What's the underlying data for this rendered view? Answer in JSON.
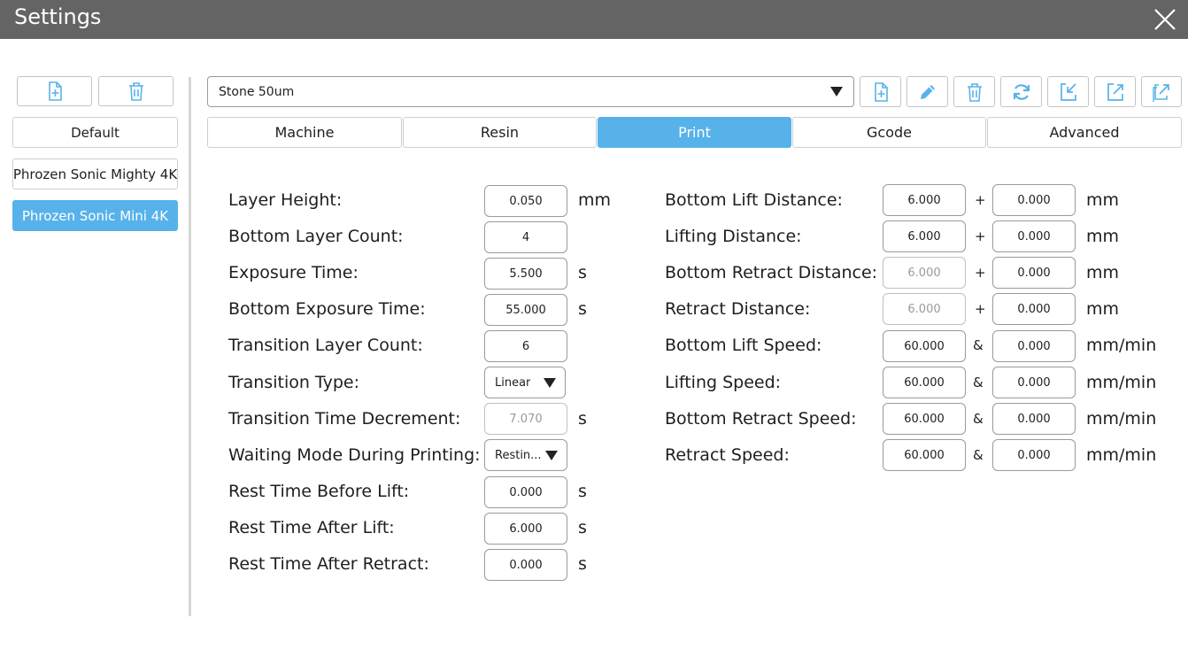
{
  "window": {
    "title": "Settings"
  },
  "icons": {
    "close": "close-icon",
    "add": "add-file-icon",
    "delete": "trash-icon",
    "edit": "pencil-icon",
    "refresh": "refresh-icon",
    "import": "import-icon",
    "export": "export-icon",
    "export_all": "export-all-icon"
  },
  "colors": {
    "accent": "#58b2ea",
    "titlebar": "#646464"
  },
  "sidebar": {
    "items": [
      {
        "label": "Default"
      },
      {
        "label": "Phrozen Sonic Mighty 4K"
      },
      {
        "label": "Phrozen Sonic Mini 4K",
        "selected": true
      }
    ]
  },
  "profile": {
    "selected": "Stone 50um"
  },
  "tabs": [
    {
      "label": "Machine"
    },
    {
      "label": "Resin"
    },
    {
      "label": "Print",
      "active": true
    },
    {
      "label": "Gcode"
    },
    {
      "label": "Advanced"
    }
  ],
  "print": {
    "left": [
      {
        "label": "Layer Height:",
        "value": "0.050",
        "unit": "mm"
      },
      {
        "label": "Bottom Layer Count:",
        "value": "4",
        "unit": ""
      },
      {
        "label": "Exposure Time:",
        "value": "5.500",
        "unit": "s"
      },
      {
        "label": "Bottom Exposure Time:",
        "value": "55.000",
        "unit": "s"
      },
      {
        "label": "Transition Layer Count:",
        "value": "6",
        "unit": ""
      },
      {
        "label": "Transition Type:",
        "value": "Linear",
        "unit": ""
      },
      {
        "label": "Transition Time Decrement:",
        "value": "7.070",
        "unit": "s"
      },
      {
        "label": "Waiting Mode During Printing:",
        "value": "Restin...",
        "unit": ""
      },
      {
        "label": "Rest Time Before Lift:",
        "value": "0.000",
        "unit": "s"
      },
      {
        "label": "Rest Time After Lift:",
        "value": "6.000",
        "unit": "s"
      },
      {
        "label": "Rest Time After Retract:",
        "value": "0.000",
        "unit": "s"
      }
    ],
    "right": [
      {
        "label": "Bottom Lift Distance:",
        "value1": "6.000",
        "op": "+",
        "value2": "0.000",
        "unit": "mm"
      },
      {
        "label": "Lifting Distance:",
        "value1": "6.000",
        "op": "+",
        "value2": "0.000",
        "unit": "mm"
      },
      {
        "label": "Bottom Retract Distance:",
        "value1": "6.000",
        "op": "+",
        "value2": "0.000",
        "unit": "mm"
      },
      {
        "label": "Retract Distance:",
        "value1": "6.000",
        "op": "+",
        "value2": "0.000",
        "unit": "mm"
      },
      {
        "label": "Bottom Lift Speed:",
        "value1": "60.000",
        "op": "&",
        "value2": "0.000",
        "unit": "mm/min"
      },
      {
        "label": "Lifting Speed:",
        "value1": "60.000",
        "op": "&",
        "value2": "0.000",
        "unit": "mm/min"
      },
      {
        "label": "Bottom Retract Speed:",
        "value1": "60.000",
        "op": "&",
        "value2": "0.000",
        "unit": "mm/min"
      },
      {
        "label": "Retract Speed:",
        "value1": "60.000",
        "op": "&",
        "value2": "0.000",
        "unit": "mm/min"
      }
    ]
  }
}
